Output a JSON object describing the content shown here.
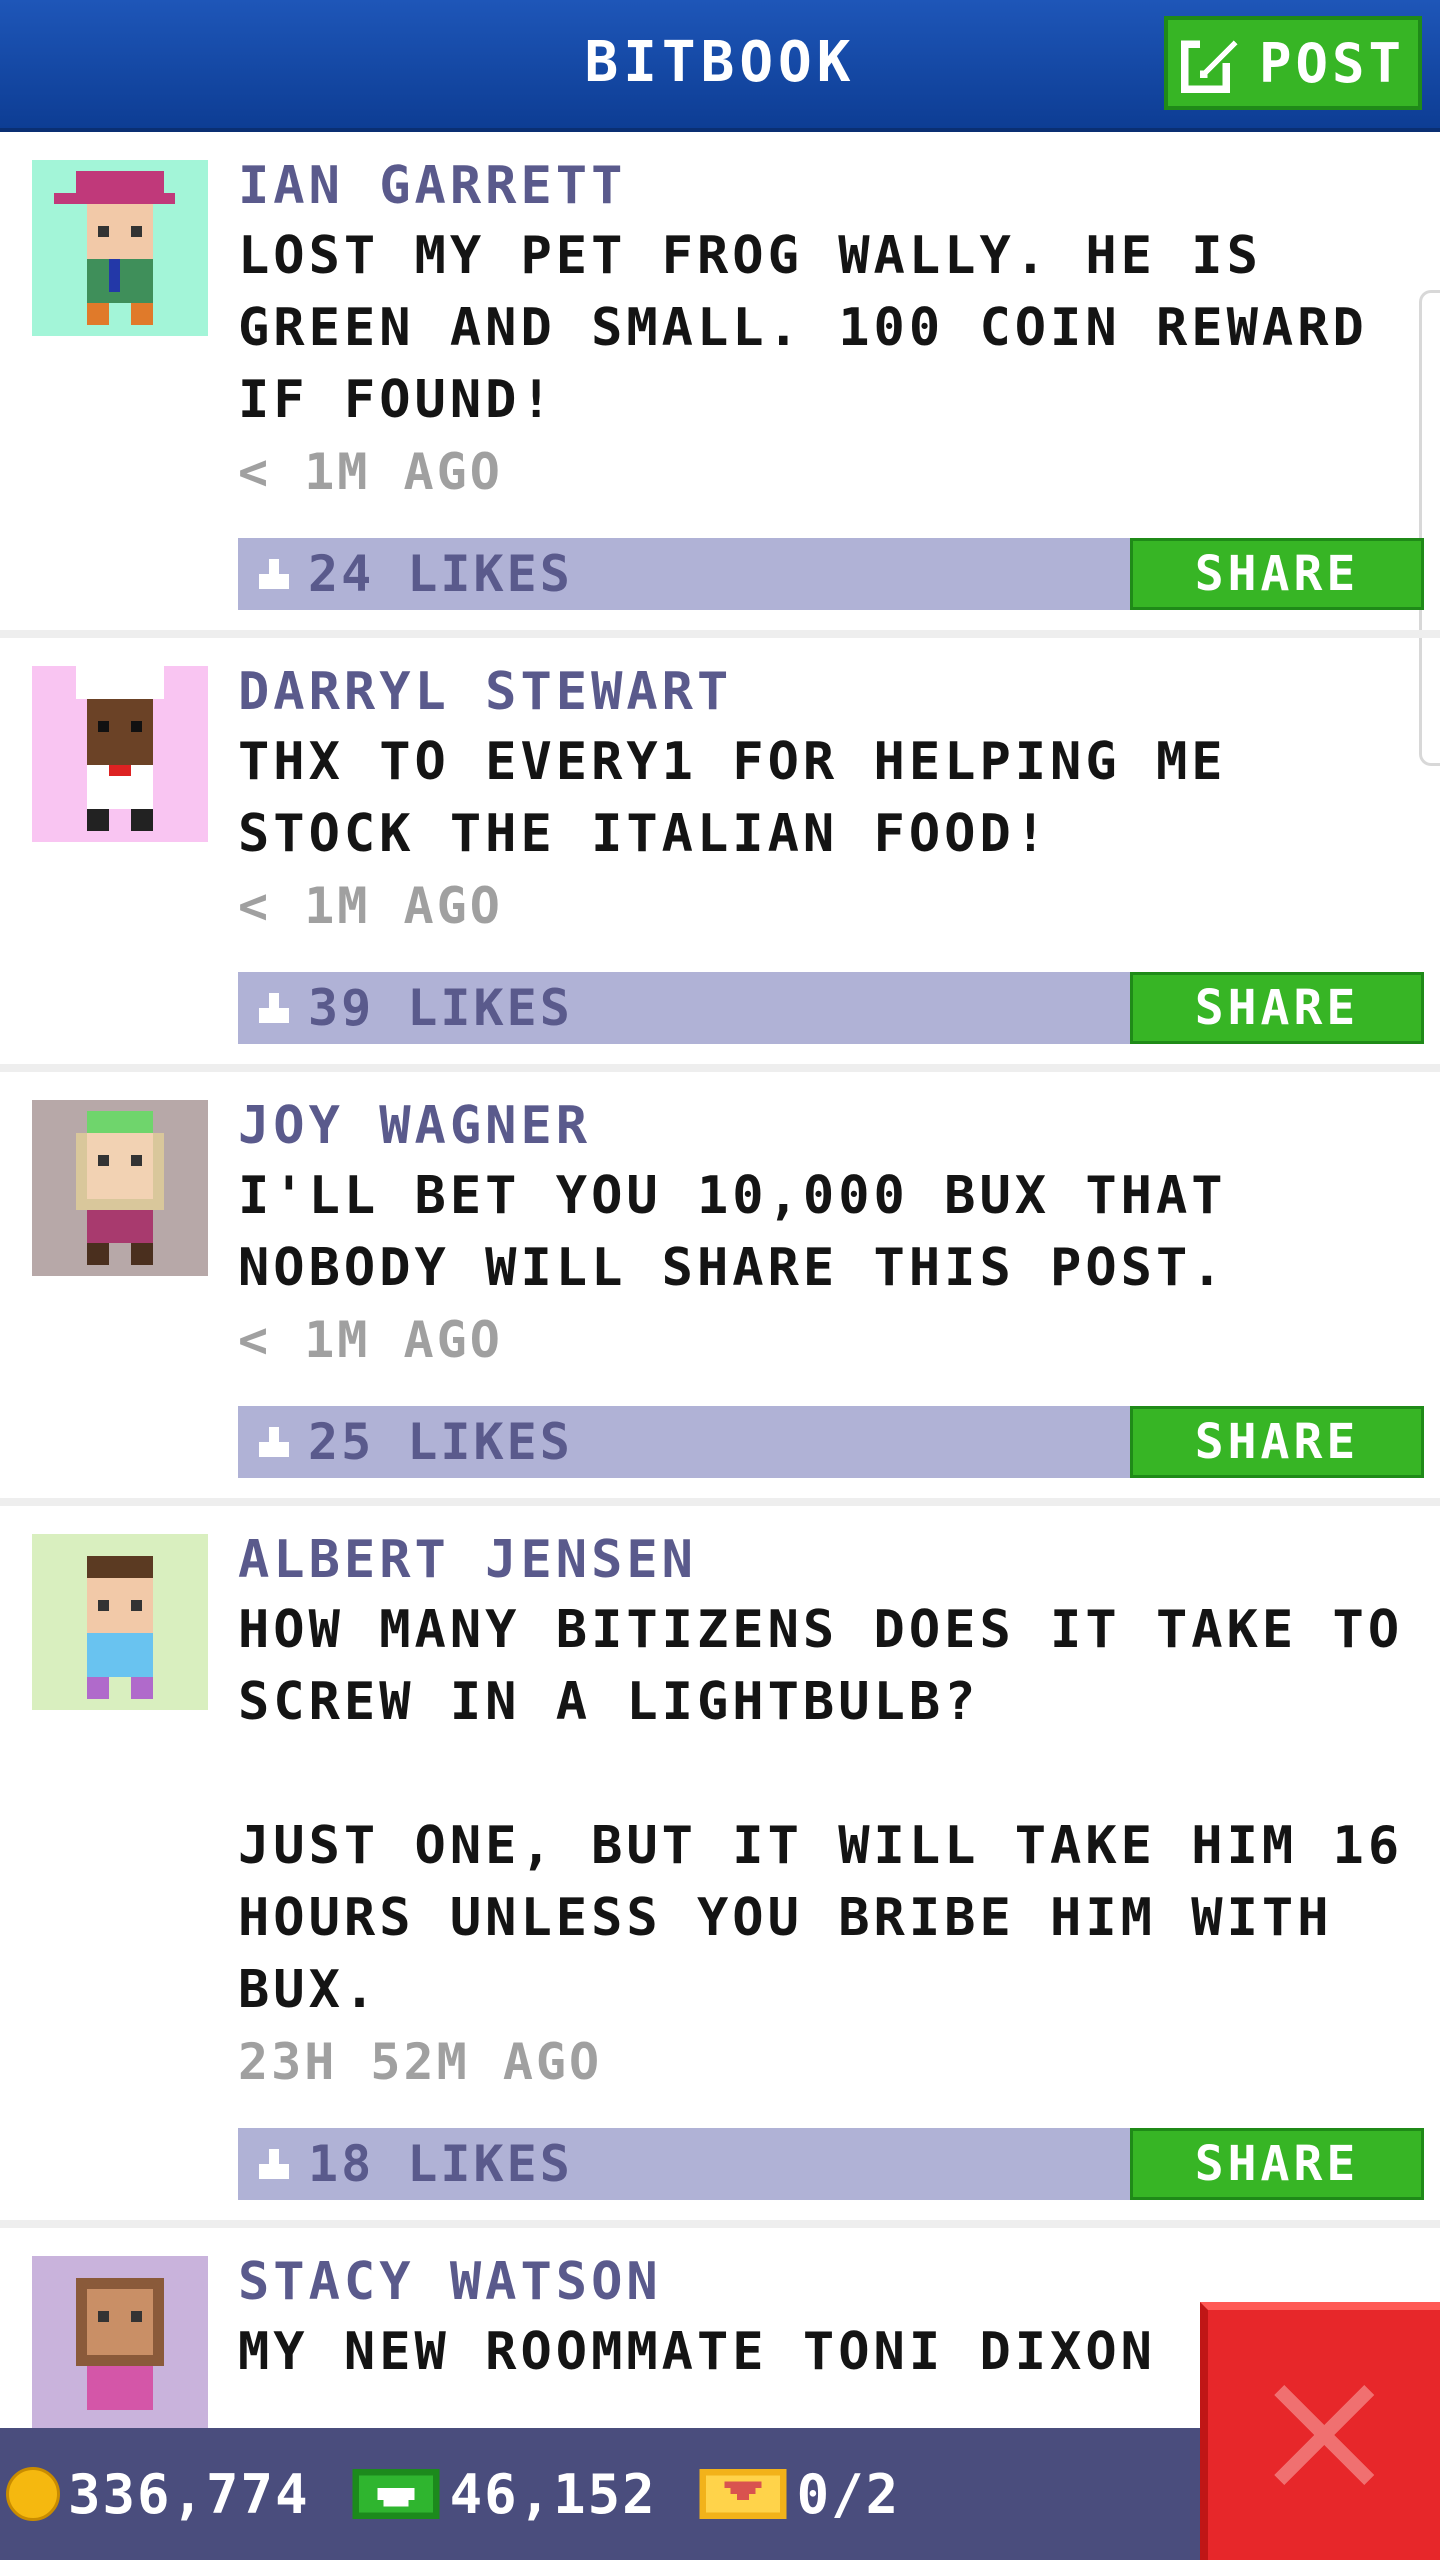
{
  "header": {
    "title": "BITBOOK",
    "post_label": "POST"
  },
  "posts": [
    {
      "author": "IAN GARRETT",
      "message": "LOST MY PET FROG WALLY. HE IS GREEN AND SMALL. 100 COIN REWARD IF FOUND!",
      "time": "< 1M AGO",
      "likes": "24 LIKES",
      "share": "SHARE"
    },
    {
      "author": "DARRYL STEWART",
      "message": "THX TO EVERY1 FOR HELPING ME STOCK THE ITALIAN FOOD!",
      "time": "< 1M AGO",
      "likes": "39 LIKES",
      "share": "SHARE"
    },
    {
      "author": "JOY WAGNER",
      "message": "I'LL BET YOU 10,000 BUX THAT NOBODY WILL SHARE THIS POST.",
      "time": "< 1M AGO",
      "likes": "25 LIKES",
      "share": "SHARE"
    },
    {
      "author": "ALBERT JENSEN",
      "message": "HOW MANY BITIZENS DOES IT TAKE TO SCREW IN A LIGHTBULB?\n\nJUST ONE, BUT IT WILL TAKE HIM 16 HOURS UNLESS YOU BRIBE HIM WITH BUX.",
      "time": "23H 52M AGO",
      "likes": "18 LIKES",
      "share": "SHARE"
    },
    {
      "author": "STACY WATSON",
      "message": "MY NEW ROOMMATE TONI DIXON"
    }
  ],
  "bottom_bar": {
    "coins": "336,774",
    "bux": "46,152",
    "tickets": "0/2"
  },
  "colors": {
    "header_blue": "#1e56b8",
    "share_green": "#37b525",
    "likebar": "#b0b2d6",
    "author_text": "#5a5a8c",
    "close_red": "#e7272a"
  },
  "icons": [
    "post-edit-icon",
    "like-icon",
    "coin-icon",
    "bux-icon",
    "ticket-icon",
    "close-icon"
  ]
}
